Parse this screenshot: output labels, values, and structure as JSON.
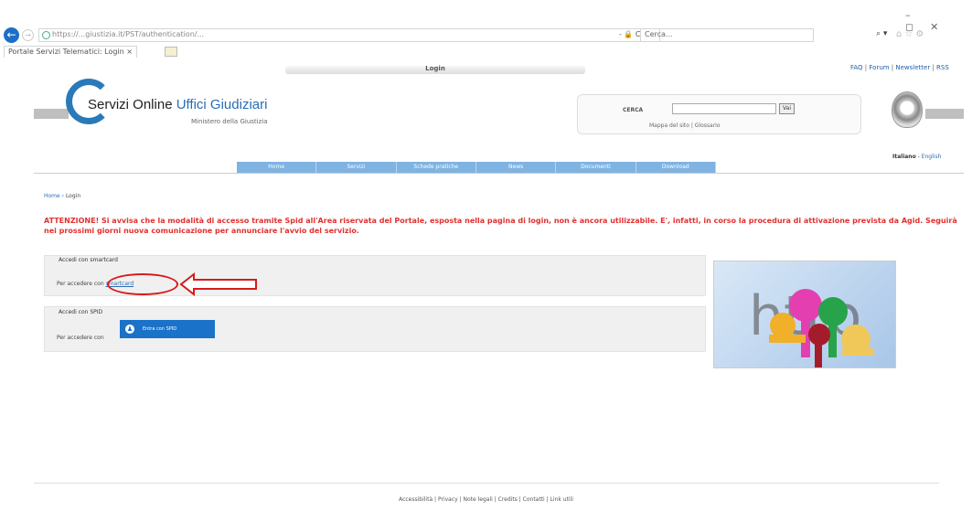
{
  "browser": {
    "url": "https://...giustizia.it/PST/authentication/...",
    "search_placeholder": "Cerca...",
    "tab_title": "Portale Servizi Telematici: Login",
    "search_icon": "search-icon"
  },
  "page": {
    "top_login_label": "Login",
    "top_links": [
      "FAQ",
      "Forum",
      "Newsletter",
      "RSS"
    ],
    "logo": {
      "title_plain": "Servizi Online ",
      "title_accent": "Uffici Giudiziari",
      "subtitle": "Ministero della Giustizia"
    },
    "search": {
      "label": "CERCA",
      "button": "Vai",
      "links": "Mappa del sito | Glossario"
    },
    "language": {
      "active": "Italiano",
      "other": "English"
    },
    "nav": [
      "Home",
      "Servizi",
      "Schede pratiche",
      "News",
      "Documenti",
      "Download"
    ],
    "breadcrumb": {
      "home": "Home",
      "current": "Login"
    },
    "warning": "ATTENZIONE! Si avvisa che la modalità di accesso tramite Spid all'Area riservata del Portale, esposta nella pagina di login, non è ancora utilizzabile. E', infatti, in corso la procedura di attivazione prevista da Agid. Seguirà nei prossimi giorni nuova comunicazione per annunciare l'avvio del servizio.",
    "smartcard": {
      "title": "Accedi con smartcard",
      "text": "Per accedere con ",
      "link": "smartcard"
    },
    "spid": {
      "title": "Accedi con SPID",
      "text": "Per accedere con",
      "button": "Entra con SPID"
    },
    "footer": "Accessibilità | Privacy | Note legali | Credits | Contatti | Link utili"
  }
}
